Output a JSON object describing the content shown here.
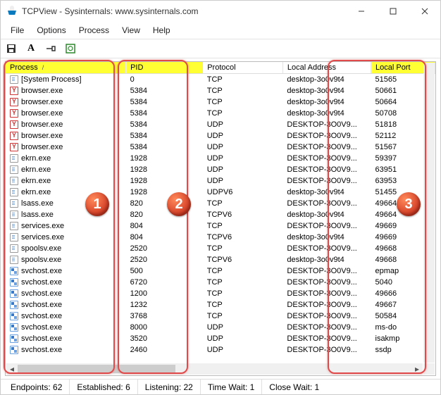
{
  "window": {
    "title": "TCPView - Sysinternals: www.sysinternals.com"
  },
  "menu": {
    "file": "File",
    "options": "Options",
    "process": "Process",
    "view": "View",
    "help": "Help"
  },
  "columns": {
    "process": "Process",
    "pid": "PID",
    "protocol": "Protocol",
    "local_address": "Local Address",
    "local_port": "Local Port"
  },
  "rows": [
    {
      "icon": "doc",
      "process": "[System Process]",
      "pid": "0",
      "proto": "TCP",
      "laddr": "desktop-3o0v9t4",
      "lport": "51565"
    },
    {
      "icon": "y",
      "process": "browser.exe",
      "pid": "5384",
      "proto": "TCP",
      "laddr": "desktop-3o0v9t4",
      "lport": "50661"
    },
    {
      "icon": "y",
      "process": "browser.exe",
      "pid": "5384",
      "proto": "TCP",
      "laddr": "desktop-3o0v9t4",
      "lport": "50664"
    },
    {
      "icon": "y",
      "process": "browser.exe",
      "pid": "5384",
      "proto": "TCP",
      "laddr": "desktop-3o0v9t4",
      "lport": "50708"
    },
    {
      "icon": "y",
      "process": "browser.exe",
      "pid": "5384",
      "proto": "UDP",
      "laddr": "DESKTOP-3O0V9...",
      "lport": "51818"
    },
    {
      "icon": "y",
      "process": "browser.exe",
      "pid": "5384",
      "proto": "UDP",
      "laddr": "DESKTOP-3O0V9...",
      "lport": "52112"
    },
    {
      "icon": "y",
      "process": "browser.exe",
      "pid": "5384",
      "proto": "UDP",
      "laddr": "DESKTOP-3O0V9...",
      "lport": "51567"
    },
    {
      "icon": "doc",
      "process": "ekrn.exe",
      "pid": "1928",
      "proto": "UDP",
      "laddr": "DESKTOP-3O0V9...",
      "lport": "59397"
    },
    {
      "icon": "doc",
      "process": "ekrn.exe",
      "pid": "1928",
      "proto": "UDP",
      "laddr": "DESKTOP-3O0V9...",
      "lport": "63951"
    },
    {
      "icon": "doc",
      "process": "ekrn.exe",
      "pid": "1928",
      "proto": "UDP",
      "laddr": "DESKTOP-3O0V9...",
      "lport": "63953"
    },
    {
      "icon": "doc",
      "process": "ekrn.exe",
      "pid": "1928",
      "proto": "UDPV6",
      "laddr": "desktop-3o0v9t4",
      "lport": "51455"
    },
    {
      "icon": "doc",
      "process": "lsass.exe",
      "pid": "820",
      "proto": "TCP",
      "laddr": "DESKTOP-3O0V9...",
      "lport": "49664"
    },
    {
      "icon": "doc",
      "process": "lsass.exe",
      "pid": "820",
      "proto": "TCPV6",
      "laddr": "desktop-3o0v9t4",
      "lport": "49664"
    },
    {
      "icon": "doc",
      "process": "services.exe",
      "pid": "804",
      "proto": "TCP",
      "laddr": "DESKTOP-3O0V9...",
      "lport": "49669"
    },
    {
      "icon": "doc",
      "process": "services.exe",
      "pid": "804",
      "proto": "TCPV6",
      "laddr": "desktop-3o0v9t4",
      "lport": "49669"
    },
    {
      "icon": "doc",
      "process": "spoolsv.exe",
      "pid": "2520",
      "proto": "TCP",
      "laddr": "DESKTOP-3O0V9...",
      "lport": "49668"
    },
    {
      "icon": "doc",
      "process": "spoolsv.exe",
      "pid": "2520",
      "proto": "TCPV6",
      "laddr": "desktop-3o0v9t4",
      "lport": "49668"
    },
    {
      "icon": "svc",
      "process": "svchost.exe",
      "pid": "500",
      "proto": "TCP",
      "laddr": "DESKTOP-3O0V9...",
      "lport": "epmap"
    },
    {
      "icon": "svc",
      "process": "svchost.exe",
      "pid": "6720",
      "proto": "TCP",
      "laddr": "DESKTOP-3O0V9...",
      "lport": "5040"
    },
    {
      "icon": "svc",
      "process": "svchost.exe",
      "pid": "1200",
      "proto": "TCP",
      "laddr": "DESKTOP-3O0V9...",
      "lport": "49666"
    },
    {
      "icon": "svc",
      "process": "svchost.exe",
      "pid": "1232",
      "proto": "TCP",
      "laddr": "DESKTOP-3O0V9...",
      "lport": "49667"
    },
    {
      "icon": "svc",
      "process": "svchost.exe",
      "pid": "3768",
      "proto": "TCP",
      "laddr": "DESKTOP-3O0V9...",
      "lport": "50584"
    },
    {
      "icon": "svc",
      "process": "svchost.exe",
      "pid": "8000",
      "proto": "UDP",
      "laddr": "DESKTOP-3O0V9...",
      "lport": "ms-do"
    },
    {
      "icon": "svc",
      "process": "svchost.exe",
      "pid": "3520",
      "proto": "UDP",
      "laddr": "DESKTOP-3O0V9...",
      "lport": "isakmp"
    },
    {
      "icon": "svc",
      "process": "svchost.exe",
      "pid": "2460",
      "proto": "UDP",
      "laddr": "DESKTOP-3O0V9...",
      "lport": "ssdp"
    }
  ],
  "status": {
    "endpoints": "Endpoints: 62",
    "established": "Established: 6",
    "listening": "Listening: 22",
    "timewait": "Time Wait: 1",
    "closewait": "Close Wait: 1"
  },
  "badges": {
    "b1": "1",
    "b2": "2",
    "b3": "3"
  },
  "toolbarA": "A"
}
